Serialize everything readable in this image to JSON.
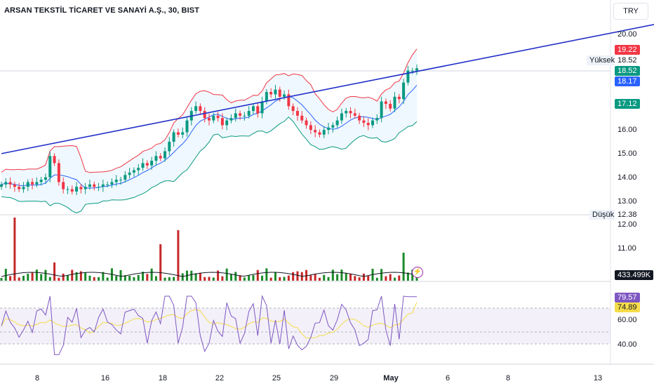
{
  "header": {
    "title": "ARSAN TEKSTİL TİCARET VE SANAYİ A.Ş., 30, BIST",
    "currency": "TRY"
  },
  "price_axis": [
    "20.00",
    "16.00",
    "15.00",
    "14.00",
    "13.00",
    "12.00",
    "11.00"
  ],
  "rsi_axis": [
    "60.00",
    "40.00"
  ],
  "x_axis": [
    "8",
    "16",
    "18",
    "22",
    "25",
    "29",
    "May",
    "6",
    "8",
    "13"
  ],
  "markers": {
    "high_label": "Yüksek",
    "high_value": "18.52",
    "low_label": "Düşük",
    "low_value": "12.38",
    "bb_upper": "19.22",
    "last_price": "18.52",
    "bb_mid": "18.17",
    "bb_lower": "17.12",
    "volume": "433.499K",
    "rsi": "79.57",
    "rsi_ma": "74.89"
  },
  "colors": {
    "up": "#089981",
    "down": "#f23645",
    "trendline": "#2130c8",
    "bb_upper": "#f23645",
    "bb_mid": "#2962ff",
    "bb_lower": "#089981",
    "rsi": "#7e57c2",
    "rsi_ma": "#f5dc4a",
    "vol_up": "#1b8a2a",
    "vol_down": "#c62828"
  },
  "icons": {
    "flash": "lightning-icon"
  },
  "chart_data": {
    "type": "line",
    "price_ylim": [
      11.0,
      20.0
    ],
    "rsi_ylim": [
      30,
      80
    ],
    "close_series": [
      13.7,
      13.8,
      13.7,
      13.6,
      13.5,
      13.6,
      13.8,
      13.7,
      13.8,
      13.9,
      14.0,
      14.9,
      14.6,
      13.8,
      13.5,
      13.5,
      13.4,
      13.6,
      13.5,
      13.6,
      13.7,
      13.6,
      13.6,
      13.7,
      13.7,
      13.8,
      13.9,
      13.9,
      14.1,
      14.2,
      14.3,
      14.4,
      14.6,
      14.5,
      14.7,
      14.9,
      14.8,
      15.1,
      15.5,
      15.9,
      15.8,
      15.9,
      16.4,
      16.8,
      17.0,
      16.8,
      16.5,
      16.4,
      16.6,
      16.5,
      16.2,
      16.4,
      16.5,
      16.7,
      16.6,
      16.6,
      16.8,
      17.0,
      16.7,
      17.2,
      17.6,
      17.5,
      17.7,
      17.4,
      17.5,
      17.0,
      16.8,
      16.6,
      16.4,
      16.2,
      16.0,
      15.9,
      15.8,
      16.0,
      16.1,
      16.2,
      16.4,
      16.7,
      16.8,
      16.7,
      16.6,
      16.4,
      16.3,
      16.2,
      16.4,
      16.5,
      17.2,
      17.1,
      16.9,
      17.4,
      17.3,
      18.0,
      18.5,
      18.5,
      18.6
    ],
    "last_price": 18.52,
    "high": 18.52,
    "low": 12.38,
    "trendline": [
      [
        0,
        15.0
      ],
      [
        160,
        20.9
      ]
    ],
    "volume_last": "433.499K",
    "rsi_last": 79.57,
    "rsi_ma_last": 74.89,
    "rsi_band": [
      40,
      70
    ]
  }
}
